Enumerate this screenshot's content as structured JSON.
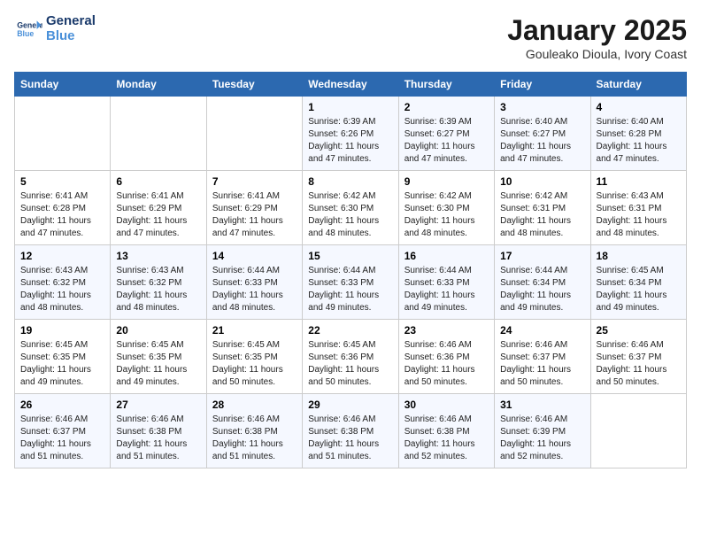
{
  "header": {
    "logo_line1": "General",
    "logo_line2": "Blue",
    "month_title": "January 2025",
    "subtitle": "Gouleako Dioula, Ivory Coast"
  },
  "weekdays": [
    "Sunday",
    "Monday",
    "Tuesday",
    "Wednesday",
    "Thursday",
    "Friday",
    "Saturday"
  ],
  "weeks": [
    [
      {
        "day": "",
        "info": ""
      },
      {
        "day": "",
        "info": ""
      },
      {
        "day": "",
        "info": ""
      },
      {
        "day": "1",
        "info": "Sunrise: 6:39 AM\nSunset: 6:26 PM\nDaylight: 11 hours\nand 47 minutes."
      },
      {
        "day": "2",
        "info": "Sunrise: 6:39 AM\nSunset: 6:27 PM\nDaylight: 11 hours\nand 47 minutes."
      },
      {
        "day": "3",
        "info": "Sunrise: 6:40 AM\nSunset: 6:27 PM\nDaylight: 11 hours\nand 47 minutes."
      },
      {
        "day": "4",
        "info": "Sunrise: 6:40 AM\nSunset: 6:28 PM\nDaylight: 11 hours\nand 47 minutes."
      }
    ],
    [
      {
        "day": "5",
        "info": "Sunrise: 6:41 AM\nSunset: 6:28 PM\nDaylight: 11 hours\nand 47 minutes."
      },
      {
        "day": "6",
        "info": "Sunrise: 6:41 AM\nSunset: 6:29 PM\nDaylight: 11 hours\nand 47 minutes."
      },
      {
        "day": "7",
        "info": "Sunrise: 6:41 AM\nSunset: 6:29 PM\nDaylight: 11 hours\nand 47 minutes."
      },
      {
        "day": "8",
        "info": "Sunrise: 6:42 AM\nSunset: 6:30 PM\nDaylight: 11 hours\nand 48 minutes."
      },
      {
        "day": "9",
        "info": "Sunrise: 6:42 AM\nSunset: 6:30 PM\nDaylight: 11 hours\nand 48 minutes."
      },
      {
        "day": "10",
        "info": "Sunrise: 6:42 AM\nSunset: 6:31 PM\nDaylight: 11 hours\nand 48 minutes."
      },
      {
        "day": "11",
        "info": "Sunrise: 6:43 AM\nSunset: 6:31 PM\nDaylight: 11 hours\nand 48 minutes."
      }
    ],
    [
      {
        "day": "12",
        "info": "Sunrise: 6:43 AM\nSunset: 6:32 PM\nDaylight: 11 hours\nand 48 minutes."
      },
      {
        "day": "13",
        "info": "Sunrise: 6:43 AM\nSunset: 6:32 PM\nDaylight: 11 hours\nand 48 minutes."
      },
      {
        "day": "14",
        "info": "Sunrise: 6:44 AM\nSunset: 6:33 PM\nDaylight: 11 hours\nand 48 minutes."
      },
      {
        "day": "15",
        "info": "Sunrise: 6:44 AM\nSunset: 6:33 PM\nDaylight: 11 hours\nand 49 minutes."
      },
      {
        "day": "16",
        "info": "Sunrise: 6:44 AM\nSunset: 6:33 PM\nDaylight: 11 hours\nand 49 minutes."
      },
      {
        "day": "17",
        "info": "Sunrise: 6:44 AM\nSunset: 6:34 PM\nDaylight: 11 hours\nand 49 minutes."
      },
      {
        "day": "18",
        "info": "Sunrise: 6:45 AM\nSunset: 6:34 PM\nDaylight: 11 hours\nand 49 minutes."
      }
    ],
    [
      {
        "day": "19",
        "info": "Sunrise: 6:45 AM\nSunset: 6:35 PM\nDaylight: 11 hours\nand 49 minutes."
      },
      {
        "day": "20",
        "info": "Sunrise: 6:45 AM\nSunset: 6:35 PM\nDaylight: 11 hours\nand 49 minutes."
      },
      {
        "day": "21",
        "info": "Sunrise: 6:45 AM\nSunset: 6:35 PM\nDaylight: 11 hours\nand 50 minutes."
      },
      {
        "day": "22",
        "info": "Sunrise: 6:45 AM\nSunset: 6:36 PM\nDaylight: 11 hours\nand 50 minutes."
      },
      {
        "day": "23",
        "info": "Sunrise: 6:46 AM\nSunset: 6:36 PM\nDaylight: 11 hours\nand 50 minutes."
      },
      {
        "day": "24",
        "info": "Sunrise: 6:46 AM\nSunset: 6:37 PM\nDaylight: 11 hours\nand 50 minutes."
      },
      {
        "day": "25",
        "info": "Sunrise: 6:46 AM\nSunset: 6:37 PM\nDaylight: 11 hours\nand 50 minutes."
      }
    ],
    [
      {
        "day": "26",
        "info": "Sunrise: 6:46 AM\nSunset: 6:37 PM\nDaylight: 11 hours\nand 51 minutes."
      },
      {
        "day": "27",
        "info": "Sunrise: 6:46 AM\nSunset: 6:38 PM\nDaylight: 11 hours\nand 51 minutes."
      },
      {
        "day": "28",
        "info": "Sunrise: 6:46 AM\nSunset: 6:38 PM\nDaylight: 11 hours\nand 51 minutes."
      },
      {
        "day": "29",
        "info": "Sunrise: 6:46 AM\nSunset: 6:38 PM\nDaylight: 11 hours\nand 51 minutes."
      },
      {
        "day": "30",
        "info": "Sunrise: 6:46 AM\nSunset: 6:38 PM\nDaylight: 11 hours\nand 52 minutes."
      },
      {
        "day": "31",
        "info": "Sunrise: 6:46 AM\nSunset: 6:39 PM\nDaylight: 11 hours\nand 52 minutes."
      },
      {
        "day": "",
        "info": ""
      }
    ]
  ]
}
